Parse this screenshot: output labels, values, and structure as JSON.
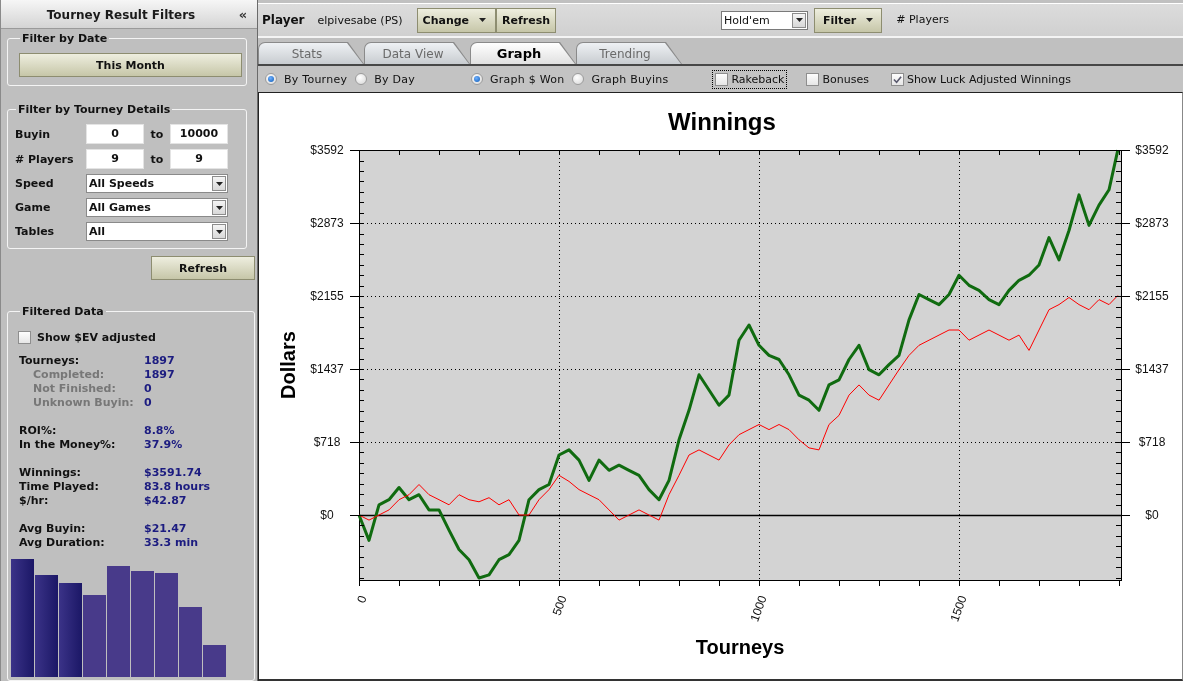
{
  "filter_panel": {
    "title": "Tourney Result Filters",
    "collapse_button": "«",
    "date_filter": {
      "legend": "Filter by Date",
      "button": "This Month"
    },
    "details_filter": {
      "legend": "Filter by Tourney Details",
      "ranges": [
        {
          "label": "Buyin",
          "from": "0",
          "separator": "to",
          "to": "10000"
        },
        {
          "label": "# Players",
          "from": "9",
          "separator": "to",
          "to": "9"
        }
      ],
      "dropdowns": [
        {
          "label": "Speed",
          "value": "All Speeds"
        },
        {
          "label": "Game",
          "value": "All Games"
        },
        {
          "label": "Tables",
          "value": "All"
        }
      ]
    },
    "refresh_button": "Refresh",
    "filtered_data": {
      "legend": "Filtered Data",
      "ev_checkbox": {
        "label": "Show $EV adjusted",
        "checked": false
      },
      "stat_groups": [
        [
          {
            "label": "Tourneys:",
            "value": "1897",
            "kind": "total"
          },
          {
            "label": "Completed:",
            "value": "1897",
            "kind": "detail"
          },
          {
            "label": "Not Finished:",
            "value": "0",
            "kind": "detail"
          },
          {
            "label": "Unknown Buyin:",
            "value": "0",
            "kind": "detail"
          }
        ],
        [
          {
            "label": "ROI%:",
            "value": "8.8%",
            "kind": "total"
          },
          {
            "label": "In the Money%:",
            "value": "37.9%",
            "kind": "total"
          }
        ],
        [
          {
            "label": "Winnings:",
            "value": "$3591.74",
            "kind": "total"
          },
          {
            "label": "Time Played:",
            "value": "83.8 hours",
            "kind": "total"
          },
          {
            "label": "$/hr:",
            "value": "$42.87",
            "kind": "total"
          }
        ],
        [
          {
            "label": "Avg Buyin:",
            "value": "$21.47",
            "kind": "total"
          },
          {
            "label": "Avg Duration:",
            "value": "33.3 min",
            "kind": "total"
          }
        ]
      ]
    }
  },
  "toolbar": {
    "player_label": "Player",
    "player_name": "elpivesabe (PS)",
    "player_buttons": [
      {
        "label": "Change",
        "dropdown": true
      },
      {
        "label": "Refresh",
        "dropdown": false
      }
    ],
    "game_select": "Hold'em",
    "filter_button": {
      "label": "Filter",
      "dropdown": true
    },
    "players_label": "# Players"
  },
  "tabs": [
    {
      "label": "Stats",
      "selected": false
    },
    {
      "label": "Data View",
      "selected": false
    },
    {
      "label": "Graph",
      "selected": true
    },
    {
      "label": "Trending",
      "selected": false
    }
  ],
  "graph_options": {
    "radio_groups": [
      [
        {
          "label": "By Tourney",
          "selected": true
        },
        {
          "label": "By Day",
          "selected": false
        }
      ],
      [
        {
          "label": "Graph $ Won",
          "selected": true
        },
        {
          "label": "Graph Buyins",
          "selected": false
        }
      ]
    ],
    "checkboxes": [
      {
        "label": "Rakeback",
        "checked": false,
        "focused": true
      },
      {
        "label": "Bonuses",
        "checked": false,
        "focused": false
      },
      {
        "label": "Show Luck Adjusted Winnings",
        "checked": true,
        "focused": false
      }
    ]
  },
  "chart": {
    "chart_data": {
      "type": "line",
      "title": "Winnings",
      "xlabel": "Tourneys",
      "ylabel": "Dollars",
      "x": [
        0,
        25,
        50,
        75,
        100,
        125,
        150,
        175,
        200,
        225,
        250,
        275,
        300,
        325,
        350,
        375,
        400,
        425,
        450,
        475,
        500,
        525,
        550,
        575,
        600,
        625,
        650,
        675,
        700,
        725,
        750,
        775,
        800,
        825,
        850,
        875,
        900,
        925,
        950,
        975,
        1000,
        1025,
        1050,
        1075,
        1100,
        1125,
        1150,
        1175,
        1200,
        1225,
        1250,
        1275,
        1300,
        1325,
        1350,
        1375,
        1400,
        1425,
        1450,
        1475,
        1500,
        1525,
        1550,
        1575,
        1600,
        1625,
        1650,
        1675,
        1700,
        1725,
        1750,
        1775,
        1800,
        1825,
        1850,
        1875,
        1897
      ],
      "series": [
        {
          "color": "#106b10",
          "values": [
            0,
            -250,
            100,
            150,
            270,
            150,
            200,
            50,
            50,
            -150,
            -340,
            -440,
            -620,
            -590,
            -440,
            -390,
            -250,
            150,
            250,
            300,
            590,
            640,
            540,
            340,
            540,
            440,
            490,
            440,
            390,
            250,
            150,
            340,
            740,
            1030,
            1380,
            1230,
            1080,
            1180,
            1720,
            1870,
            1670,
            1570,
            1530,
            1380,
            1180,
            1130,
            1030,
            1280,
            1330,
            1530,
            1670,
            1430,
            1380,
            1480,
            1570,
            1920,
            2170,
            2120,
            2070,
            2170,
            2360,
            2260,
            2210,
            2120,
            2070,
            2210,
            2310,
            2360,
            2460,
            2730,
            2510,
            2800,
            3150,
            2850,
            3050,
            3200,
            3590
          ]
        },
        {
          "color": "#ff0000",
          "values": [
            0,
            -50,
            0,
            50,
            150,
            200,
            300,
            200,
            150,
            100,
            200,
            150,
            130,
            170,
            100,
            150,
            0,
            0,
            150,
            250,
            390,
            330,
            250,
            200,
            150,
            50,
            -50,
            0,
            50,
            0,
            -50,
            200,
            390,
            590,
            640,
            590,
            540,
            690,
            790,
            840,
            890,
            840,
            890,
            840,
            740,
            660,
            640,
            890,
            980,
            1180,
            1280,
            1180,
            1130,
            1280,
            1430,
            1570,
            1670,
            1720,
            1770,
            1820,
            1820,
            1720,
            1770,
            1820,
            1770,
            1720,
            1770,
            1620,
            1820,
            2020,
            2070,
            2140,
            2070,
            2020,
            2120,
            2070,
            2160
          ]
        }
      ],
      "xlim": [
        0,
        1905
      ],
      "ylim": [
        -640,
        3592
      ],
      "xticks": [
        0,
        500,
        1000,
        1500
      ],
      "yticks": [
        {
          "value": 0,
          "label": "$0"
        },
        {
          "value": 718,
          "label": "$718"
        },
        {
          "value": 1437,
          "label": "$1437"
        },
        {
          "value": 2155,
          "label": "$2155"
        },
        {
          "value": 2873,
          "label": "$2873"
        },
        {
          "value": 3592,
          "label": "$3592"
        }
      ],
      "grid": true
    }
  }
}
